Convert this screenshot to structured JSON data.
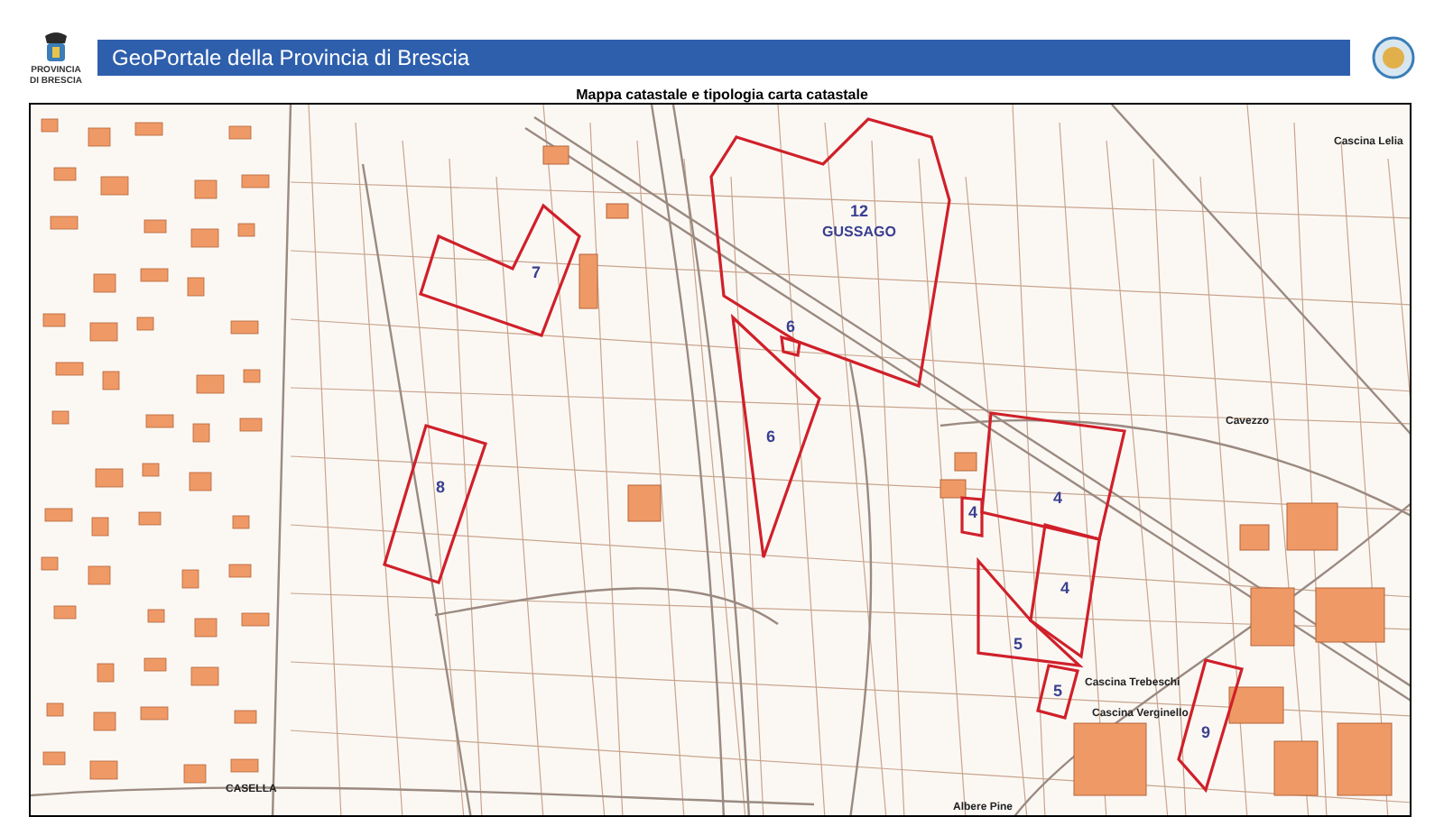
{
  "header": {
    "title": "GeoPortale della Provincia di Brescia",
    "logo_caption": "PROVINCIA DI BRESCIA"
  },
  "map": {
    "title": "Mappa catastale e tipologia carta catastale",
    "parcels": [
      {
        "number": "12",
        "name": "GUSSAGO"
      },
      {
        "number": "7"
      },
      {
        "number": "8"
      },
      {
        "number": "6"
      },
      {
        "number": "6"
      },
      {
        "number": "4"
      },
      {
        "number": "4"
      },
      {
        "number": "4"
      },
      {
        "number": "5"
      },
      {
        "number": "5"
      },
      {
        "number": "9"
      }
    ],
    "place_names": [
      "Cascina Lelia",
      "Cavezzo",
      "Cascina Trebeschi",
      "Cascina Verginello",
      "Albere Pine",
      "CASELLA"
    ]
  }
}
